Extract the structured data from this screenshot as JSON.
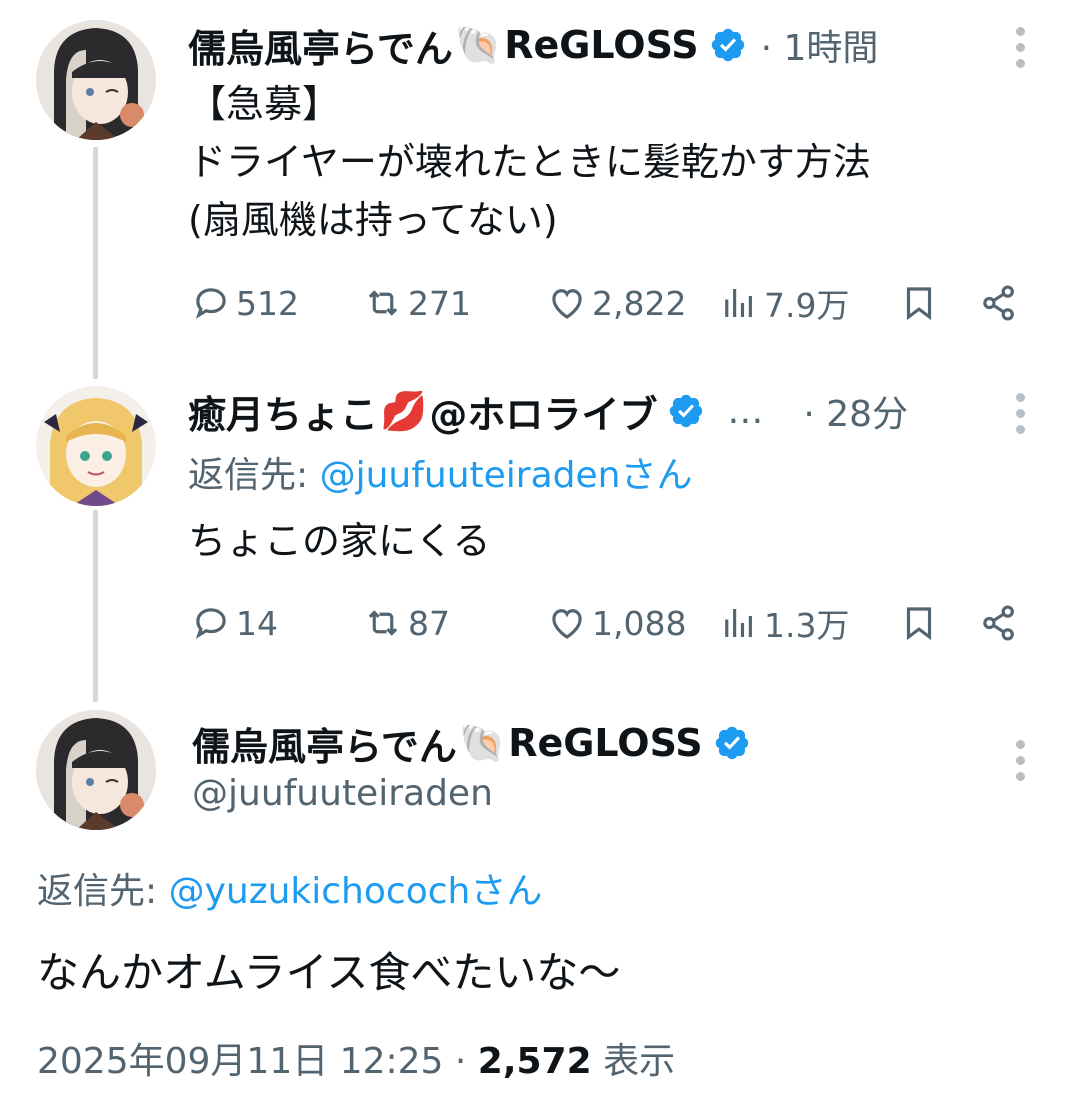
{
  "tweets": [
    {
      "name": "儒烏風亭らでん",
      "name_suffix": "ReGLOSS",
      "emoji": "🐚",
      "meta": "· 1時間",
      "text": "【急募】\nドライヤーが壊れたときに髪乾かす方法\n(扇風機は持ってない)",
      "stats": {
        "replies": "512",
        "retweets": "271",
        "likes": "2,822",
        "views": "7.9万"
      }
    },
    {
      "name": "癒月ちょこ",
      "name_suffix": "@ホロライブ",
      "emoji": "💋",
      "ellipsis": "…",
      "meta": "· 28分",
      "reply_prefix": "返信先: ",
      "reply_handle": "@juufuuteiradenさん",
      "text": "ちょこの家にくる",
      "stats": {
        "replies": "14",
        "retweets": "87",
        "likes": "1,088",
        "views": "1.3万"
      }
    },
    {
      "name": "儒烏風亭らでん",
      "name_suffix": "ReGLOSS",
      "emoji": "🐚",
      "handle": "@juufuuteiraden",
      "reply_prefix": "返信先: ",
      "reply_handle": "@yuzukichocochさん",
      "text": "なんかオムライス食べたいな〜",
      "timestamp": "2025年09月11日 12:25 · ",
      "view_count": "2,572",
      "view_label": " 表示"
    }
  ],
  "colors": {
    "accent": "#1d9bf0",
    "secondary_text": "#536471",
    "thread_line": "#cfd9de"
  },
  "icons": [
    "reply-icon",
    "retweet-icon",
    "like-icon",
    "views-icon",
    "bookmark-icon",
    "share-icon",
    "verified-badge-icon",
    "more-icon"
  ]
}
